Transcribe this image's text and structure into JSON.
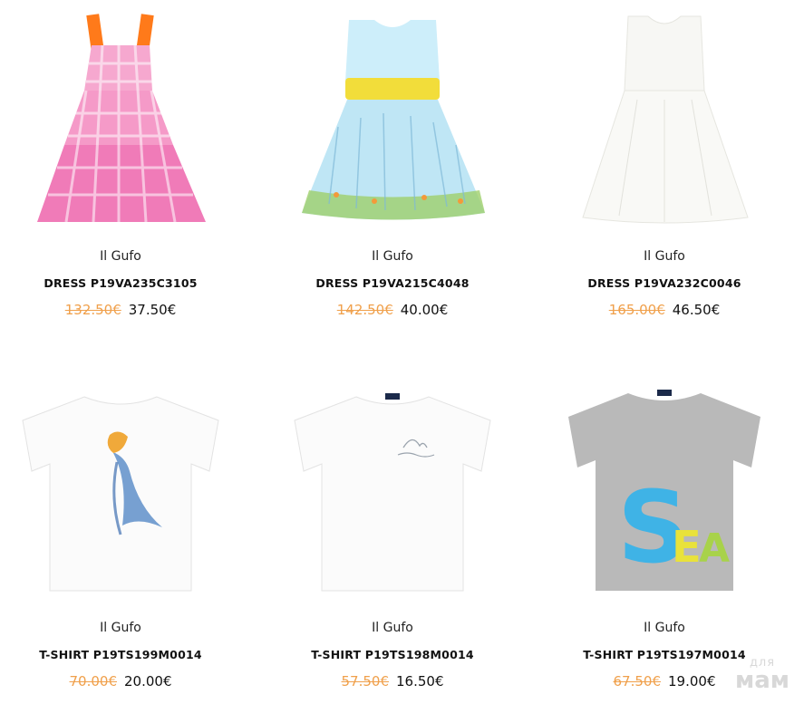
{
  "products": [
    {
      "brand": "Il Gufo",
      "title": "DRESS P19VA235C3105",
      "old_price": "132.50€",
      "price": "37.50€",
      "image": "pink-gingham-dress-image"
    },
    {
      "brand": "Il Gufo",
      "title": "DRESS P19VA215C4048",
      "old_price": "142.50€",
      "price": "40.00€",
      "image": "blue-meadow-dress-image"
    },
    {
      "brand": "Il Gufo",
      "title": "DRESS P19VA232C0046",
      "old_price": "165.00€",
      "price": "46.50€",
      "image": "white-dress-image"
    },
    {
      "brand": "Il Gufo",
      "title": "T-SHIRT P19TS199M0014",
      "old_price": "70.00€",
      "price": "20.00€",
      "image": "white-tshirt-fish-image"
    },
    {
      "brand": "Il Gufo",
      "title": "T-SHIRT P19TS198M0014",
      "old_price": "57.50€",
      "price": "16.50€",
      "image": "white-tshirt-shark-image"
    },
    {
      "brand": "Il Gufo",
      "title": "T-SHIRT P19TS197M0014",
      "old_price": "67.50€",
      "price": "19.00€",
      "image": "grey-tshirt-sea-image"
    }
  ],
  "watermark": {
    "line1": "для",
    "line2": "мам"
  },
  "colors": {
    "old_price": "#f0a04b",
    "pink": "#f07bb8",
    "orange_strap": "#ff7a1a",
    "sky": "#bfe6f5",
    "sash": "#f2dd3a",
    "grey_tee": "#b9b9b9",
    "sea_blue": "#3fb3e6",
    "sea_yellow": "#e9e23a"
  }
}
